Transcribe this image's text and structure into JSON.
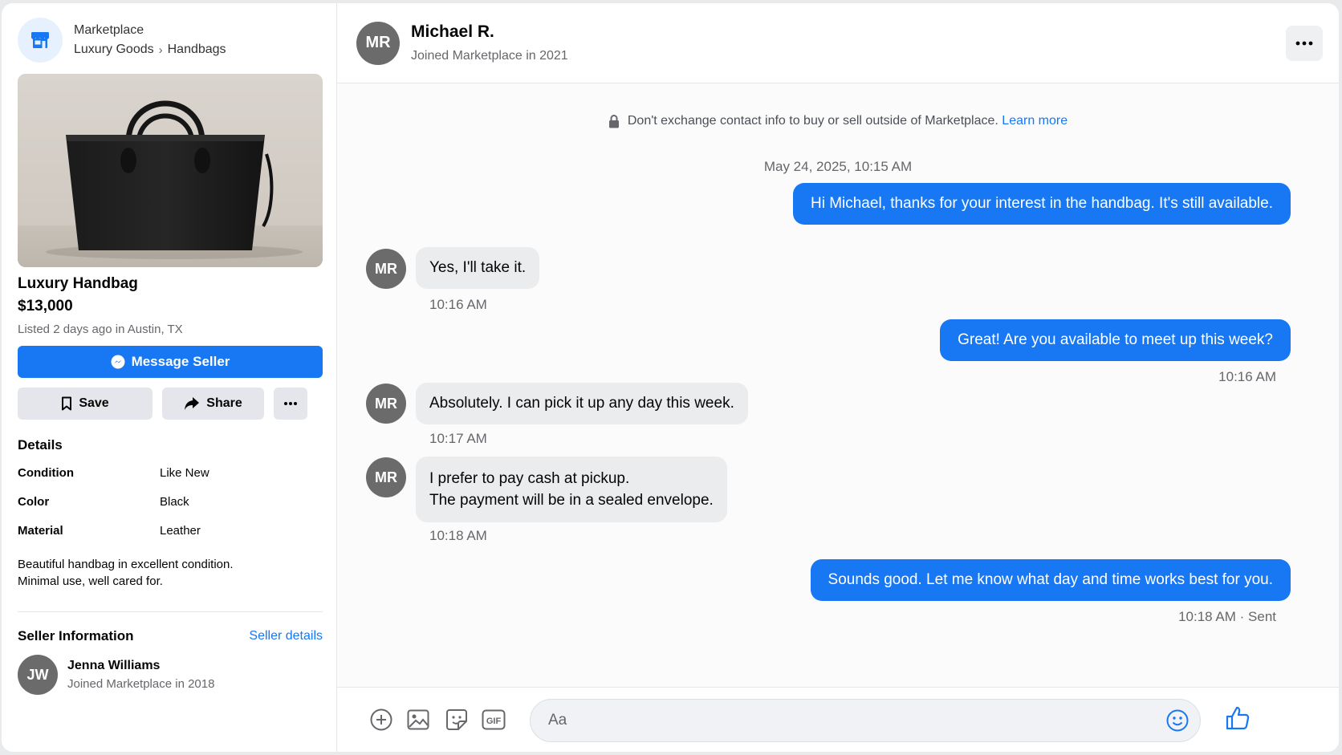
{
  "breadcrumb": {
    "root": "Marketplace",
    "category": "Luxury Goods",
    "separator": "›",
    "subcategory": "Handbags"
  },
  "listing": {
    "title": "Luxury Handbag",
    "price": "$13,000",
    "listed": "Listed 2 days ago in Austin, TX",
    "message_seller_label": "Message Seller",
    "save_label": "Save",
    "share_label": "Share",
    "details_title": "Details",
    "details": [
      {
        "key": "Condition",
        "value": "Like New"
      },
      {
        "key": "Color",
        "value": "Black"
      },
      {
        "key": "Material",
        "value": "Leather"
      }
    ],
    "description_line1": "Beautiful handbag in excellent condition.",
    "description_line2": "Minimal use, well cared for."
  },
  "seller": {
    "section_title": "Seller Information",
    "details_link": "Seller details",
    "initials": "JW",
    "name": "Jenna Williams",
    "joined": "Joined Marketplace in 2018"
  },
  "chat": {
    "contact_initials": "MR",
    "contact_name": "Michael R.",
    "contact_joined": "Joined Marketplace in 2021",
    "notice_text": "Don't exchange contact info to buy or sell outside of Marketplace.",
    "notice_link": "Learn more",
    "date": "May 24, 2025, 10:15 AM",
    "messages": [
      {
        "from": "me",
        "text": "Hi Michael, thanks for your interest in the handbag. It's still available."
      },
      {
        "from": "them",
        "text": "Yes, I'll take it.",
        "time": "10:16 AM"
      },
      {
        "from": "me",
        "text": "Great! Are you available to meet up this week?",
        "time": "10:16 AM"
      },
      {
        "from": "them",
        "text": "Absolutely. I can pick it up any day this week.",
        "time": "10:17 AM"
      },
      {
        "from": "them",
        "line1": "I prefer to pay cash at pickup.",
        "line2": "The payment will be in a sealed envelope.",
        "time": "10:18 AM"
      },
      {
        "from": "me",
        "text": "Sounds good. Let me know what day and time works best for you.",
        "time": "10:18 AM · Sent"
      }
    ],
    "composer_placeholder": "Aa"
  },
  "colors": {
    "accent": "#1877f2",
    "incoming_bubble": "#ebecee",
    "avatar": "#6b6b6b"
  },
  "icons": [
    "store-icon",
    "messenger-icon",
    "bookmark-icon",
    "share-arrow-icon",
    "more-dots-icon",
    "lock-icon",
    "plus-circle-icon",
    "image-icon",
    "sticker-icon",
    "gif-icon",
    "emoji-icon",
    "thumbs-up-icon"
  ]
}
